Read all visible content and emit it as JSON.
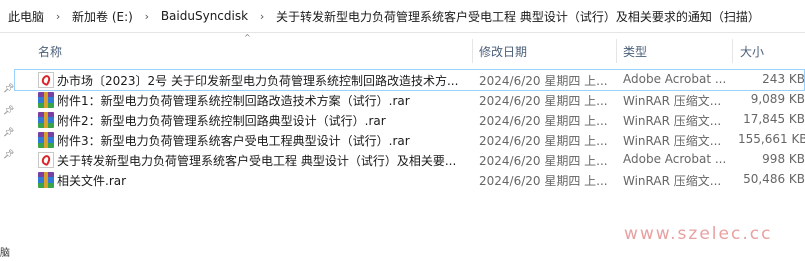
{
  "breadcrumb": {
    "items": [
      "此电脑",
      "新加卷 (E:)",
      "BaiduSyncdisk",
      "关于转发新型电力负荷管理系统客户受电工程 典型设计（试行）及相关要求的通知（扫描）"
    ]
  },
  "columns": {
    "name": "名称",
    "date": "修改日期",
    "type": "类型",
    "size": "大小"
  },
  "files": [
    {
      "icon": "pdf-icon",
      "name": "办市场〔2023〕2号 关于印发新型电力负荷管理系统控制回路改造技术方...",
      "date": "2024/6/20 星期四 上...",
      "type": "Adobe Acrobat ...",
      "size": "243 KB",
      "selected": true
    },
    {
      "icon": "rar-icon",
      "name": "附件1：新型电力负荷管理系统控制回路改造技术方案（试行）.rar",
      "date": "2024/6/20 星期四 上...",
      "type": "WinRAR 压缩文...",
      "size": "9,089 KB",
      "selected": false
    },
    {
      "icon": "rar-icon",
      "name": "附件2：新型电力负荷管理系统控制回路典型设计（试行）.rar",
      "date": "2024/6/20 星期四 上...",
      "type": "WinRAR 压缩文...",
      "size": "17,845 KB",
      "selected": false
    },
    {
      "icon": "rar-icon",
      "name": "附件3：新型电力负荷管理系统客户受电工程典型设计（试行）.rar",
      "date": "2024/6/20 星期四 上...",
      "type": "WinRAR 压缩文...",
      "size": "155,661 KB",
      "selected": false
    },
    {
      "icon": "pdf-icon",
      "name": "关于转发新型电力负荷管理系统客户受电工程 典型设计（试行）及相关要...",
      "date": "2024/6/20 星期四 上...",
      "type": "Adobe Acrobat ...",
      "size": "998 KB",
      "selected": false
    },
    {
      "icon": "rar-icon",
      "name": "相关文件.rar",
      "date": "2024/6/20 星期四 上...",
      "type": "WinRAR 压缩文...",
      "size": "50,486 KB",
      "selected": false
    }
  ],
  "left_pane": {
    "cut_label": "脑"
  },
  "watermark": "www.szelec.cc"
}
